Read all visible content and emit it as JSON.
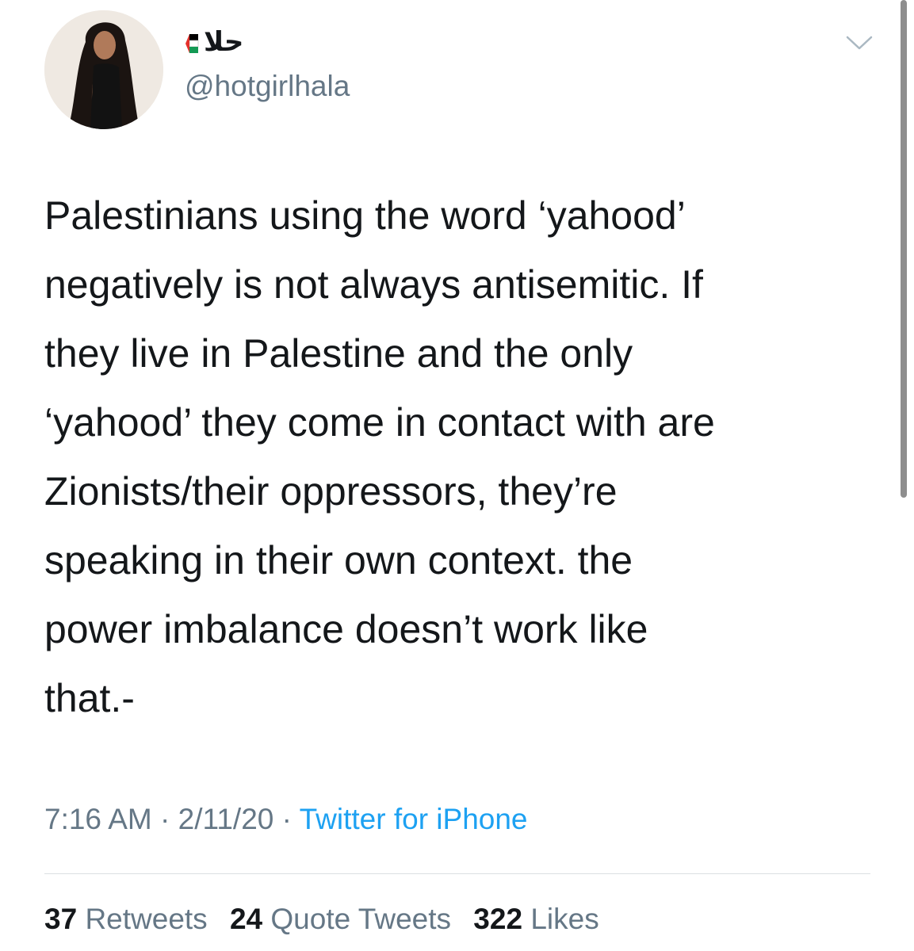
{
  "user": {
    "display_name": "حلا",
    "handle": "@hotgirlhala"
  },
  "icons": {
    "flag": "palestine-flag-icon",
    "menu": "chevron-down-icon"
  },
  "tweet": {
    "lines": [
      "Palestinians using the word ‘yahood’",
      "negatively is not always antisemitic. If",
      "they live in Palestine and the only",
      "‘yahood’ they come in contact with are",
      "Zionists/their oppressors, they’re",
      "speaking in their own context. the",
      "power imbalance doesn’t work like",
      "that.-"
    ]
  },
  "meta": {
    "time": "7:16 AM",
    "separator": "·",
    "date": "2/11/20",
    "source": "Twitter for iPhone"
  },
  "stats": {
    "retweets": {
      "count": "37",
      "label": "Retweets"
    },
    "quotes": {
      "count": "24",
      "label": "Quote Tweets"
    },
    "likes": {
      "count": "322",
      "label": "Likes"
    }
  },
  "colors": {
    "text": "#14171a",
    "secondary": "#657786",
    "link": "#1da1f2",
    "flag_black": "#000000",
    "flag_white": "#ffffff",
    "flag_green": "#149954",
    "flag_red": "#e4312b"
  }
}
